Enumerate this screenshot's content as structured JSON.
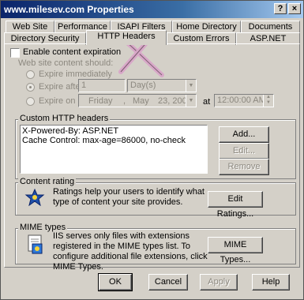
{
  "window": {
    "title": "www.milesev.com Properties",
    "help_btn": "?",
    "close_btn": "×"
  },
  "tabs_row1": [
    "Web Site",
    "Performance",
    "ISAPI Filters",
    "Home Directory",
    "Documents"
  ],
  "tabs_row2": [
    "Directory Security",
    "HTTP Headers",
    "Custom Errors",
    "ASP.NET"
  ],
  "expiration": {
    "enable_label": "Enable content expiration",
    "sub_label": "Web site content should:",
    "immediately": "Expire immediately",
    "after": "Expire after",
    "after_value": "1",
    "after_unit": "Day(s)",
    "on": "Expire on",
    "date_day": "Friday",
    "date_month": "May",
    "date_num": "23, 2008",
    "at_label": "at",
    "time": "12:00:00 AM"
  },
  "custom_headers": {
    "label": "Custom HTTP headers",
    "items": [
      "X-Powered-By: ASP.NET",
      "Cache Control: max-age=86000, no-check"
    ],
    "add": "Add...",
    "edit": "Edit...",
    "remove": "Remove"
  },
  "content_rating": {
    "label": "Content rating",
    "text": "Ratings help your users to identify what type of content your site provides.",
    "button": "Edit Ratings..."
  },
  "mime": {
    "label": "MIME types",
    "text": "IIS serves only files with extensions registered in the MIME types list. To configure additional file extensions, click MIME Types.",
    "button": "MIME Types..."
  },
  "footer": {
    "ok": "OK",
    "cancel": "Cancel",
    "apply": "Apply",
    "help": "Help"
  },
  "colors": {
    "title_bar": "#0a246a",
    "face": "#d4d0c8",
    "annotation_x": "#d8a8c8"
  }
}
